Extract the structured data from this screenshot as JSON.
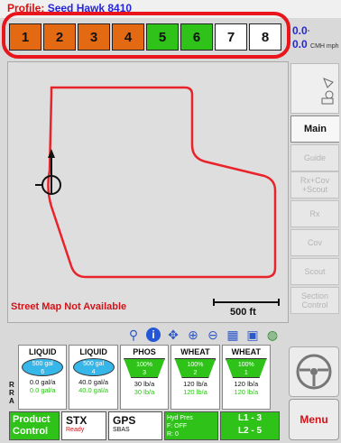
{
  "header": {
    "profile_prefix": "Profile:",
    "profile_name": "Seed Hawk 8410"
  },
  "sections": [
    {
      "label": "1",
      "state": "orange"
    },
    {
      "label": "2",
      "state": "orange"
    },
    {
      "label": "3",
      "state": "orange"
    },
    {
      "label": "4",
      "state": "orange"
    },
    {
      "label": "5",
      "state": "green"
    },
    {
      "label": "6",
      "state": "green"
    },
    {
      "label": "7",
      "state": "white"
    },
    {
      "label": "8",
      "state": "white"
    }
  ],
  "speed": {
    "value1": "0.0",
    "unit1": "°",
    "value2": "0.0",
    "unit2": "CMH mph"
  },
  "map": {
    "street_message": "Street Map Not Available",
    "scale_label": "500 ft"
  },
  "right_tabs": [
    {
      "label": "Main",
      "active": true
    },
    {
      "label": "Guide",
      "active": false
    },
    {
      "label": "Rx+Cov +Scout",
      "active": false
    },
    {
      "label": "Rx",
      "active": false
    },
    {
      "label": "Cov",
      "active": false
    },
    {
      "label": "Scout",
      "active": false
    },
    {
      "label": "Section Control",
      "active": false
    }
  ],
  "bins": [
    {
      "name": "LIQUID",
      "kind": "tank",
      "fill": "500 gal",
      "num": "6",
      "rate": "0.0 gal/a",
      "rate2": "0.0 gal/a"
    },
    {
      "name": "LIQUID",
      "kind": "tank",
      "fill": "500 gal",
      "num": "4",
      "rate": "40.0 gal/a",
      "rate2": "40.0 gal/a"
    },
    {
      "name": "PHOS",
      "kind": "hopper",
      "fill": "100%",
      "num": "3",
      "rate": "30 lb/a",
      "rate2": "30 lb/a"
    },
    {
      "name": "WHEAT",
      "kind": "hopper",
      "fill": "100%",
      "num": "2",
      "rate": "120 lb/a",
      "rate2": "120 lb/a"
    },
    {
      "name": "WHEAT",
      "kind": "hopper",
      "fill": "100%",
      "num": "1",
      "rate": "120 lb/a",
      "rate2": "120 lb/a"
    }
  ],
  "rx_label": "R\nR A",
  "bottom": {
    "product_control": "Product Control",
    "stx_title": "STX",
    "stx_status": "Ready",
    "gps_title": "GPS",
    "gps_status": "SBAS",
    "hyd_line1": "Hyd Pres",
    "hyd_line2": "F: OFF",
    "hyd_line3": "R: 0",
    "lanes_line1": "L1 - 3",
    "lanes_line2": "L2 - 5",
    "menu": "Menu"
  },
  "colors": {
    "section_orange": "#e36a12",
    "section_green": "#2fc31a",
    "highlight": "#e8151c",
    "boundary": "#e8232a"
  },
  "icons": [
    "ruler-icon",
    "info-icon",
    "pan-icon",
    "zoom-in-icon",
    "zoom-out-icon",
    "grid-icon",
    "layers-icon",
    "globe-icon",
    "steering-wheel-icon",
    "orientation-icon"
  ]
}
